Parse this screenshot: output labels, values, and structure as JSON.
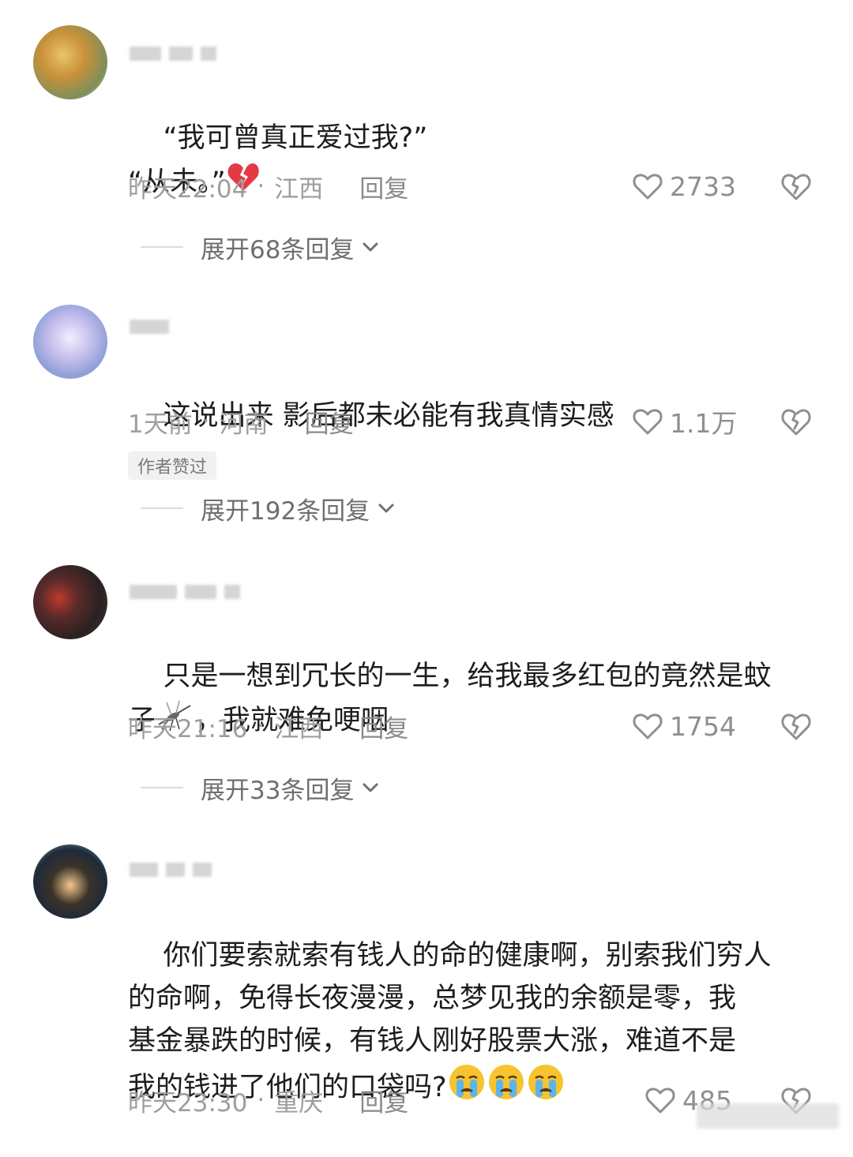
{
  "comments": [
    {
      "text": "“我可曾真正爱过我?”\n“从未。”",
      "time": "昨天22:04",
      "location": "江西",
      "reply_label": "回复",
      "likes": "2733",
      "expand_label": "展开68条回复"
    },
    {
      "text": "这说出来 影后都未必能有我真情实感",
      "time": "1天前",
      "location": "河南",
      "reply_label": "回复",
      "likes": "1.1万",
      "badge": "作者赞过",
      "expand_label": "展开192条回复"
    },
    {
      "text": "只是一想到冗长的一生，给我最多红包的竟然是蚊\n子",
      "text_tail": "，我就难免哽咽",
      "time": "昨天21:16",
      "location": "江西",
      "reply_label": "回复",
      "likes": "1754",
      "expand_label": "展开33条回复"
    },
    {
      "text": "你们要索就索有钱人的命的健康啊，别索我们穷人\n的命啊，免得长夜漫漫，总梦见我的余额是零，我\n基金暴跌的时候，有钱人刚好股票大涨，难道不是\n我的钱进了他们的口袋吗?",
      "time": "昨天23:30",
      "location": "重庆",
      "reply_label": "回复",
      "likes": "485"
    }
  ],
  "colors": {
    "broken_heart": "#e53945",
    "text_primary": "#1d1d1d",
    "text_meta": "#9e9e9e"
  },
  "icons": [
    "heart-outline-icon",
    "broken-heart-dislike-icon",
    "chevron-down-icon",
    "broken-heart-emoji",
    "mosquito-emoji",
    "crying-face-emoji"
  ]
}
